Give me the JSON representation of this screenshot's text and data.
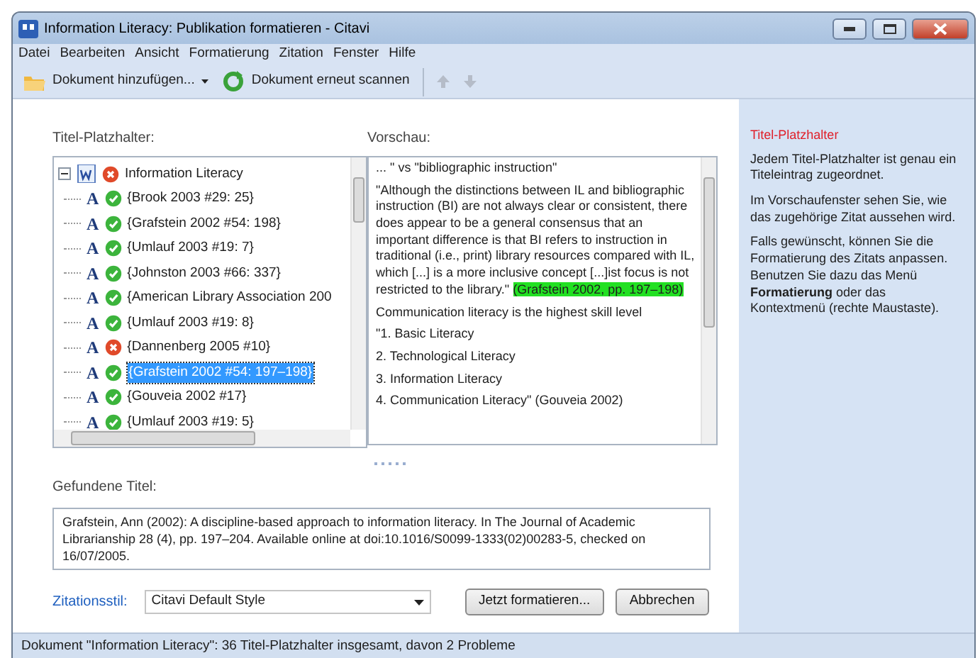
{
  "window": {
    "title": "Information Literacy: Publikation formatieren - Citavi"
  },
  "menu": [
    "Datei",
    "Bearbeiten",
    "Ansicht",
    "Formatierung",
    "Zitation",
    "Fenster",
    "Hilfe"
  ],
  "toolbar": [
    {
      "kind": "folder",
      "label": "Dokument hinzufügen...",
      "dropdown": true
    },
    {
      "kind": "refresh",
      "label": "Dokument erneut scannen",
      "dropdown": false
    },
    {
      "kind": "up",
      "disabled": true
    },
    {
      "kind": "down",
      "disabled": true
    }
  ],
  "placeholders": {
    "label": "Titel-Platzhalter:",
    "root": {
      "label": "Information Literacy",
      "ok": false,
      "expanded": true
    },
    "items": [
      {
        "icon": "A",
        "label": "{Brook 2003 #29: 25}",
        "ok": true,
        "selected": false
      },
      {
        "icon": "A",
        "label": "{Grafstein 2002 #54: 198}",
        "ok": true,
        "selected": false
      },
      {
        "icon": "A",
        "label": "{Umlauf 2003 #19: 7}",
        "ok": true,
        "selected": false
      },
      {
        "icon": "A",
        "label": "{Johnston 2003 #66: 337}",
        "ok": true,
        "selected": false
      },
      {
        "icon": "A",
        "label": "{American Library Association 200",
        "ok": true,
        "selected": false
      },
      {
        "icon": "A",
        "label": "{Umlauf 2003 #19: 8}",
        "ok": true,
        "selected": false
      },
      {
        "icon": "A",
        "label": "{Dannenberg 2005 #10}",
        "ok": false,
        "selected": false
      },
      {
        "icon": "A",
        "label": "{Grafstein 2002 #54: 197–198}",
        "ok": true,
        "selected": true
      },
      {
        "icon": "A",
        "label": "{Gouveia 2002 #17}",
        "ok": true,
        "selected": false
      },
      {
        "icon": "A",
        "label": "{Umlauf 2003 #19: 5}",
        "ok": true,
        "selected": false
      }
    ]
  },
  "preview": {
    "label": "Vorschau:",
    "paragraphs": [
      {
        "text": "... \" vs \"bibliographic instruction\""
      },
      {
        "text": "\"Although the distinctions between IL and bibliographic instruction (BI) are not always clear or consistent, there does appear to be a general consensus that an important difference is that BI refers to instruction in traditional (i.e., print) library resources compared with IL, which [...] is a more inclusive concept [...]ist focus is not restricted to the library.\"",
        "highlight": "(Grafstein 2002, pp. 197–198)"
      },
      {
        "text": "Communication literacy is the highest skill level"
      },
      {
        "text": "\"1. Basic Literacy"
      },
      {
        "text": "2. Technological Literacy"
      },
      {
        "text": "3. Information Literacy"
      },
      {
        "text": "4. Communication Literacy\" (Gouveia 2002)"
      }
    ]
  },
  "found": {
    "label": "Gefundene Titel:",
    "text": "Grafstein, Ann (2002): A discipline-based approach to information literacy. In The Journal of Academic Librarianship 28 (4), pp. 197–204. Available online at doi:10.1016/S0099-1333(02)00283-5, checked on 16/07/2005."
  },
  "style": {
    "label": "Zitationsstil:",
    "value": "Citavi Default Style"
  },
  "buttons": [
    "Jetzt formatieren...",
    "Abbrechen"
  ],
  "help": {
    "title": "Titel-Platzhalter",
    "paragraphs": [
      "Jedem Titel-Platzhalter ist genau ein Titeleintrag zugeordnet.",
      "Im Vorschaufenster sehen Sie, wie das zugehörige Zitat aussehen wird.",
      "Falls gewünscht, können Sie die Formatierung des Zitats anpassen. Benutzen Sie dazu das Menü **Formatierung** oder das Kontextmenü (rechte Maustaste)."
    ]
  },
  "status_bar": "Dokument \"Information Literacy\": 36 Titel-Platzhalter insgesamt, davon 2 Probleme"
}
